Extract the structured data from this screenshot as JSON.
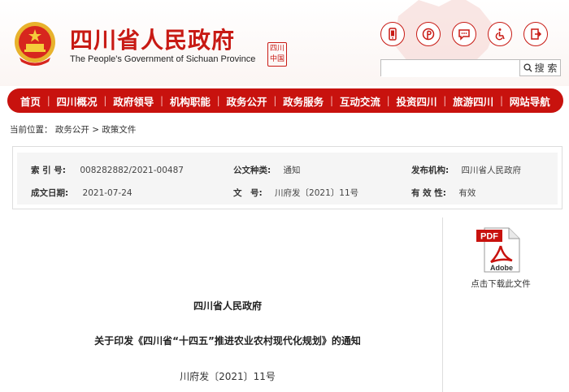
{
  "header": {
    "title": "四川省人民政府",
    "subtitle": "The People's Government of Sichuan Province",
    "seal_text": "四川中国",
    "search": {
      "placeholder": "",
      "button_label": "搜 索"
    },
    "icons": [
      "mobile-icon",
      "pinterest-icon",
      "chat-icon",
      "accessibility-icon",
      "exit-icon"
    ],
    "brand_color": "#c8120e"
  },
  "nav": {
    "items": [
      "首页",
      "四川概况",
      "政府领导",
      "机构职能",
      "政务公开",
      "政务服务",
      "互动交流",
      "投资四川",
      "旅游四川",
      "网站导航"
    ]
  },
  "breadcrumb": {
    "prefix": "当前位置：",
    "items": [
      "政务公开",
      "政策文件"
    ],
    "separator": ">"
  },
  "info": {
    "index_label": "索 引 号:",
    "index_value": "008282882/2021-00487",
    "category_label": "公文种类:",
    "category_value": "通知",
    "publisher_label": "发布机构:",
    "publisher_value": "四川省人民政府",
    "date_label": "成文日期:",
    "date_value": "2021-07-24",
    "docno_label": "文　号:",
    "docno_value": "川府发〔2021〕11号",
    "validity_label": "有 效 性:",
    "validity_value": "有效"
  },
  "document": {
    "issuer": "四川省人民政府",
    "title": "关于印发《四川省“十四五”推进农业农村现代化规划》的通知",
    "number": "川府发〔2021〕11号"
  },
  "download": {
    "pdf_label": "PDF",
    "brand_label": "Adobe",
    "caption": "点击下载此文件"
  }
}
